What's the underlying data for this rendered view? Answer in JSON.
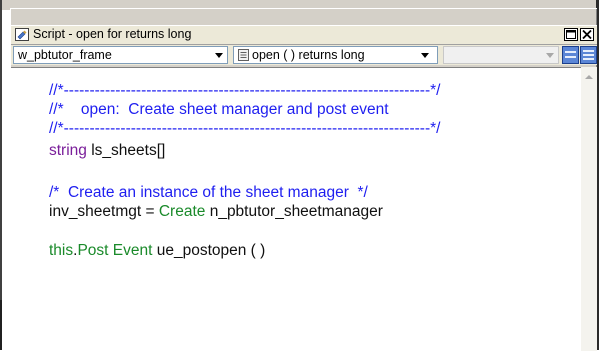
{
  "window": {
    "title": "Script - open for  returns long",
    "minimize_glyph": "□",
    "close_glyph": "×"
  },
  "toolbar": {
    "object_combo": "w_pbtutor_frame",
    "event_combo": "open ( )  returns long",
    "ancestor_combo": ""
  },
  "code": {
    "line1": "//*-----------------------------------------------------------------------*/",
    "line2": "//*    open:  Create sheet manager and post event",
    "line3": "//*-----------------------------------------------------------------------*/",
    "line4_kw": "string",
    "line4_rest": " ls_sheets[]",
    "line6": "/*  Create an instance of the sheet manager  */",
    "line7_a": "inv_sheetmgt = ",
    "line7_kw": "Create",
    "line7_b": " n_pbtutor_sheetmanager",
    "line9_a": "this",
    "line9_dot": ".",
    "line9_b": "Post Event",
    "line9_c": " ue_postopen ( )"
  },
  "colors": {
    "comment": "#1e1ef0",
    "keyword": "#7a1e9a",
    "function": "#1a8a2a",
    "text": "#101010"
  }
}
